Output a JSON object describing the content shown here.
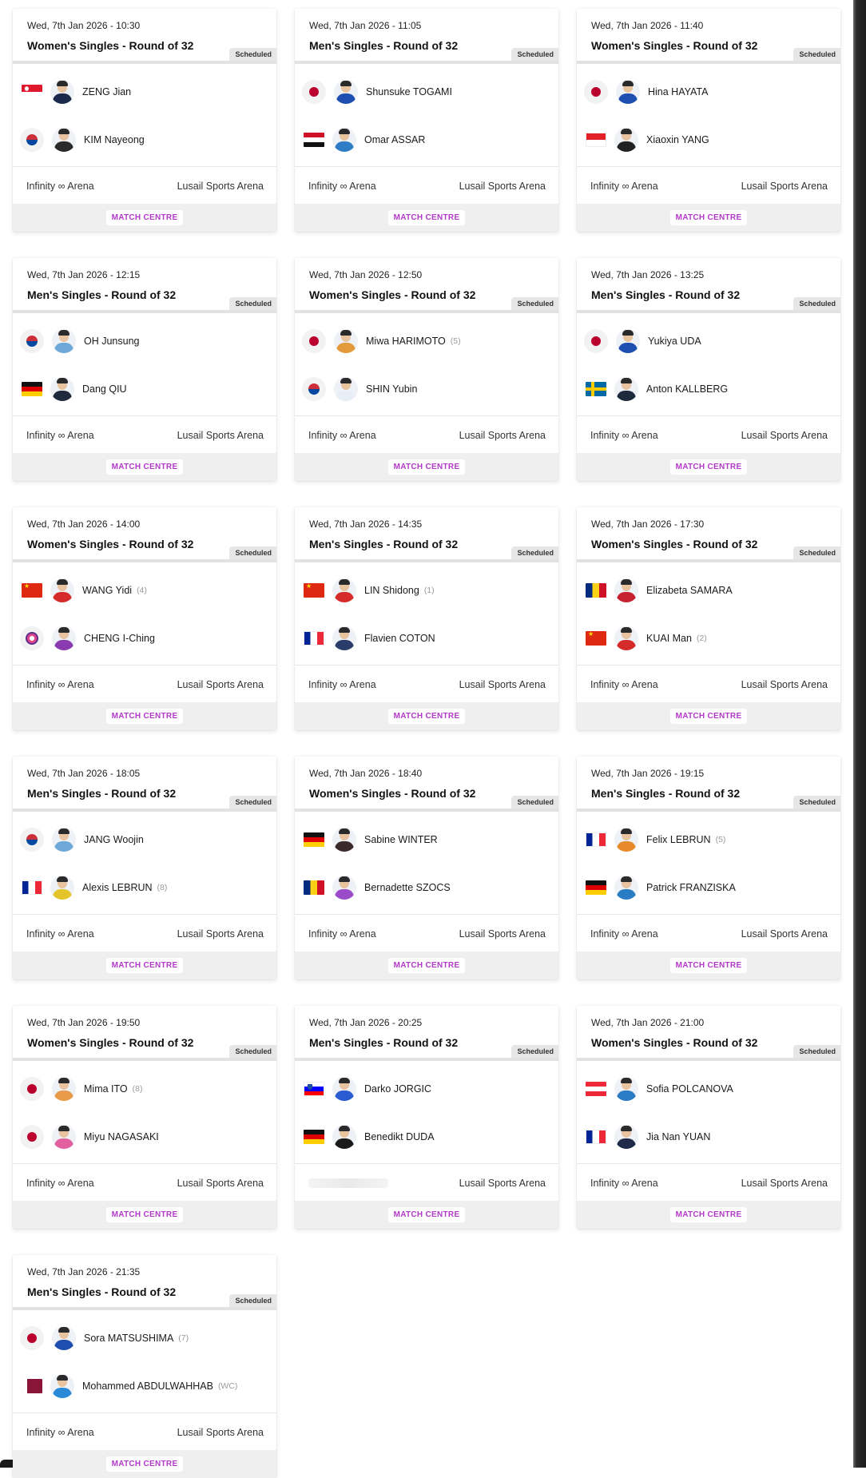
{
  "labels": {
    "status": "Scheduled",
    "match_centre": "MATCH CENTRE",
    "venue_left": "Infinity ∞ Arena",
    "venue_right": "Lusail Sports Arena"
  },
  "matches": [
    {
      "datetime": "Wed, 7th Jan 2026 - 10:30",
      "event": "Women's Singles - Round of 32",
      "p1": {
        "name": "ZENG Jian",
        "seed": "",
        "flag": "SGP",
        "kit": "#1b2a4a"
      },
      "p2": {
        "name": "KIM Nayeong",
        "seed": "",
        "flag": "KOR",
        "kit": "#2a2a2a"
      }
    },
    {
      "datetime": "Wed, 7th Jan 2026 - 11:05",
      "event": "Men's Singles - Round of 32",
      "p1": {
        "name": "Shunsuke TOGAMI",
        "seed": "",
        "flag": "JPN",
        "kit": "#1e4fb0"
      },
      "p2": {
        "name": "Omar ASSAR",
        "seed": "",
        "flag": "EGY",
        "kit": "#2f7dc4"
      }
    },
    {
      "datetime": "Wed, 7th Jan 2026 - 11:40",
      "event": "Women's Singles - Round of 32",
      "p1": {
        "name": "Hina HAYATA",
        "seed": "",
        "flag": "JPN",
        "kit": "#1e4fb0"
      },
      "p2": {
        "name": "Xiaoxin YANG",
        "seed": "",
        "flag": "IDN",
        "kit": "#222222"
      }
    },
    {
      "datetime": "Wed, 7th Jan 2026 - 12:15",
      "event": "Men's Singles - Round of 32",
      "p1": {
        "name": "OH Junsung",
        "seed": "",
        "flag": "KOR",
        "kit": "#6ea8d8"
      },
      "p2": {
        "name": "Dang QIU",
        "seed": "",
        "flag": "GER",
        "kit": "#1f2a3c"
      }
    },
    {
      "datetime": "Wed, 7th Jan 2026 - 12:50",
      "event": "Women's Singles - Round of 32",
      "p1": {
        "name": "Miwa HARIMOTO",
        "seed": "(5)",
        "flag": "JPN",
        "kit": "#e39a3a"
      },
      "p2": {
        "name": "SHIN Yubin",
        "seed": "",
        "flag": "KOR",
        "kit": "#e8eef6"
      }
    },
    {
      "datetime": "Wed, 7th Jan 2026 - 13:25",
      "event": "Men's Singles - Round of 32",
      "p1": {
        "name": "Yukiya UDA",
        "seed": "",
        "flag": "JPN",
        "kit": "#1e4fb0"
      },
      "p2": {
        "name": "Anton KALLBERG",
        "seed": "",
        "flag": "SWE",
        "kit": "#1f2a3c"
      }
    },
    {
      "datetime": "Wed, 7th Jan 2026 - 14:00",
      "event": "Women's Singles - Round of 32",
      "p1": {
        "name": "WANG Yidi",
        "seed": "(4)",
        "flag": "CHN",
        "kit": "#d62b2b"
      },
      "p2": {
        "name": "CHENG I-Ching",
        "seed": "",
        "flag": "TPE",
        "kit": "#8a3bb0"
      }
    },
    {
      "datetime": "Wed, 7th Jan 2026 - 14:35",
      "event": "Men's Singles - Round of 32",
      "p1": {
        "name": "LIN Shidong",
        "seed": "(1)",
        "flag": "CHN",
        "kit": "#d62b2b"
      },
      "p2": {
        "name": "Flavien COTON",
        "seed": "",
        "flag": "FRA",
        "kit": "#2a3d6a"
      }
    },
    {
      "datetime": "Wed, 7th Jan 2026 - 17:30",
      "event": "Women's Singles - Round of 32",
      "p1": {
        "name": "Elizabeta SAMARA",
        "seed": "",
        "flag": "ROU",
        "kit": "#c7202f"
      },
      "p2": {
        "name": "KUAI Man",
        "seed": "(2)",
        "flag": "CHN",
        "kit": "#d62b2b"
      }
    },
    {
      "datetime": "Wed, 7th Jan 2026 - 18:05",
      "event": "Men's Singles - Round of 32",
      "p1": {
        "name": "JANG Woojin",
        "seed": "",
        "flag": "KOR",
        "kit": "#6ea8d8"
      },
      "p2": {
        "name": "Alexis LEBRUN",
        "seed": "(8)",
        "flag": "FRA",
        "kit": "#e3c52a"
      }
    },
    {
      "datetime": "Wed, 7th Jan 2026 - 18:40",
      "event": "Women's Singles - Round of 32",
      "p1": {
        "name": "Sabine WINTER",
        "seed": "",
        "flag": "GER",
        "kit": "#3a2a2a"
      },
      "p2": {
        "name": "Bernadette SZOCS",
        "seed": "",
        "flag": "ROU",
        "kit": "#9a4cc8"
      }
    },
    {
      "datetime": "Wed, 7th Jan 2026 - 19:15",
      "event": "Men's Singles - Round of 32",
      "p1": {
        "name": "Felix LEBRUN",
        "seed": "(5)",
        "flag": "FRA",
        "kit": "#e88a2a"
      },
      "p2": {
        "name": "Patrick FRANZISKA",
        "seed": "",
        "flag": "GER",
        "kit": "#2a7cc4"
      }
    },
    {
      "datetime": "Wed, 7th Jan 2026 - 19:50",
      "event": "Women's Singles - Round of 32",
      "p1": {
        "name": "Mima ITO",
        "seed": "(8)",
        "flag": "JPN",
        "kit": "#e89a4a"
      },
      "p2": {
        "name": "Miyu NAGASAKI",
        "seed": "",
        "flag": "JPN",
        "kit": "#e35fa0"
      }
    },
    {
      "datetime": "Wed, 7th Jan 2026 - 20:25",
      "event": "Men's Singles - Round of 32",
      "p1": {
        "name": "Darko JORGIC",
        "seed": "",
        "flag": "SVN",
        "kit": "#2a5bd0"
      },
      "p2": {
        "name": "Benedikt DUDA",
        "seed": "",
        "flag": "GER",
        "kit": "#1a1a1a"
      }
    },
    {
      "datetime": "Wed, 7th Jan 2026 - 21:00",
      "event": "Women's Singles - Round of 32",
      "p1": {
        "name": "Sofia POLCANOVA",
        "seed": "",
        "flag": "AUT",
        "kit": "#2a7cc4"
      },
      "p2": {
        "name": "Jia Nan YUAN",
        "seed": "",
        "flag": "FRA",
        "kit": "#1f2a4a"
      }
    },
    {
      "datetime": "Wed, 7th Jan 2026 - 21:35",
      "event": "Men's Singles - Round of 32",
      "p1": {
        "name": "Sora MATSUSHIMA",
        "seed": "(7)",
        "flag": "JPN",
        "kit": "#1e4fb0"
      },
      "p2": {
        "name": "Mohammed ABDULWAHHAB",
        "seed": "(WC)",
        "flag": "QAT",
        "kit": "#2a8ad8"
      }
    }
  ]
}
